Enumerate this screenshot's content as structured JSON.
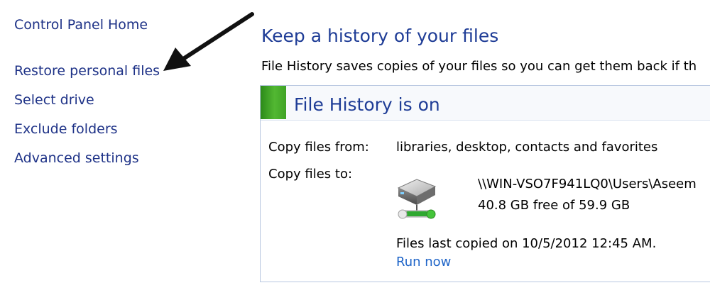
{
  "sidebar": {
    "items": [
      {
        "label": "Control Panel Home"
      },
      {
        "label": "Restore personal files"
      },
      {
        "label": "Select drive"
      },
      {
        "label": "Exclude folders"
      },
      {
        "label": "Advanced settings"
      }
    ]
  },
  "main": {
    "title": "Keep a history of your files",
    "intro": "File History saves copies of your files so you can get them back if th",
    "panel": {
      "status_title": "File History is on",
      "status_color": "#3ea225",
      "copy_from_label": "Copy files from:",
      "copy_from_value": "libraries, desktop, contacts and favorites",
      "copy_to_label": "Copy files to:",
      "drive_path": "\\\\WIN-VSO7F941LQ0\\Users\\Aseem",
      "drive_space": "40.8 GB free of 59.9 GB",
      "last_copied": "Files last copied on 10/5/2012 12:45 AM.",
      "run_now_label": "Run now"
    }
  },
  "icons": {
    "annotation_arrow": "arrow-icon",
    "drive": "network-drive-icon"
  }
}
